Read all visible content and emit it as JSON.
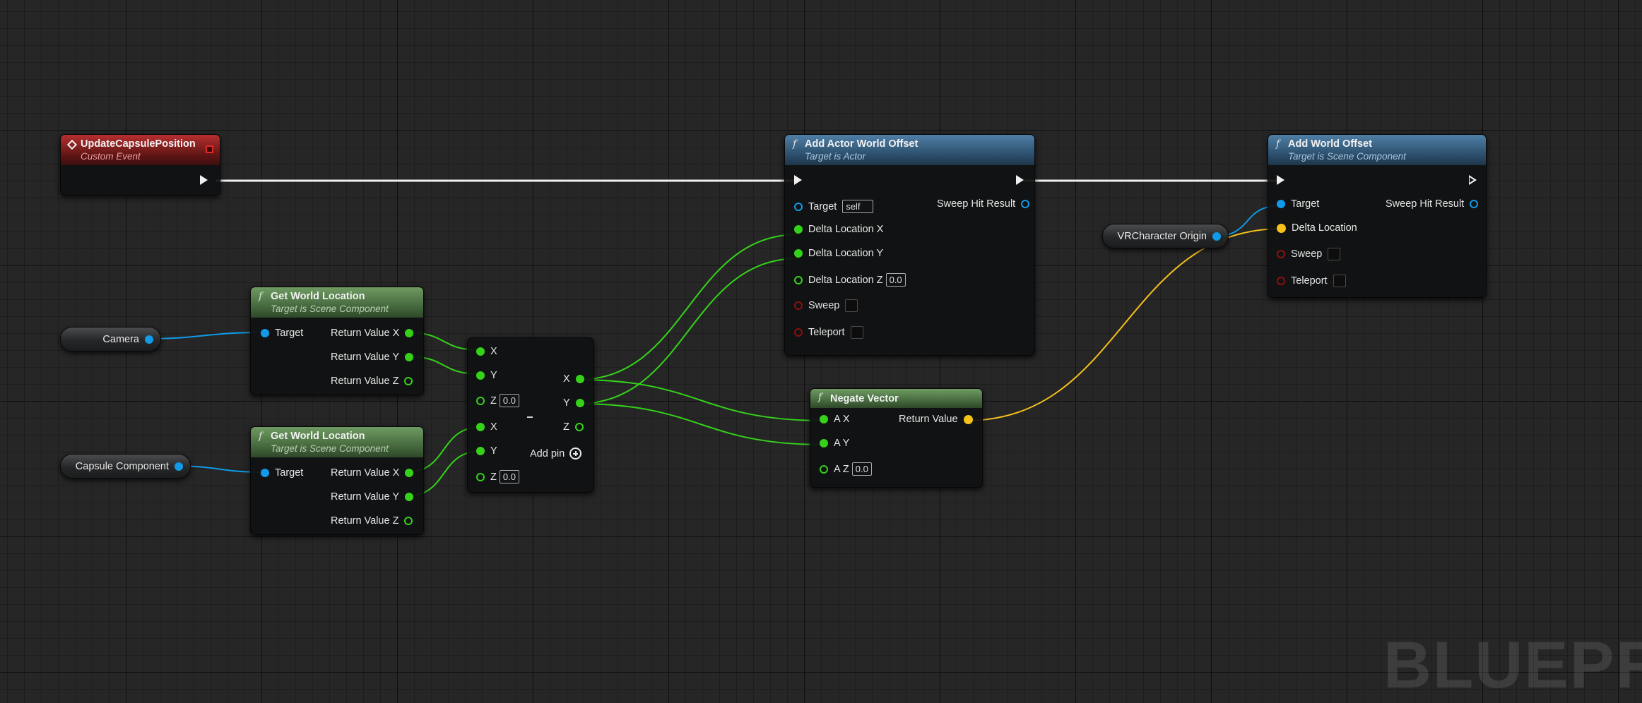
{
  "colors": {
    "background": "#262626",
    "exec_wire": "#f0f0f0",
    "float_pin": "#35d21a",
    "object_pin": "#109ae8",
    "vector_pin": "#f6c21a",
    "bool_pin": "#8c1010"
  },
  "event": {
    "title": "UpdateCapsulePosition",
    "subtitle": "Custom Event"
  },
  "add_actor_offset": {
    "title": "Add Actor World Offset",
    "subtitle": "Target is Actor",
    "target": "Target",
    "target_default": "self",
    "sweep_hit": "Sweep Hit Result",
    "dlx": "Delta Location X",
    "dly": "Delta Location Y",
    "dlz": "Delta Location Z",
    "dlz_default": "0.0",
    "sweep": "Sweep",
    "teleport": "Teleport"
  },
  "add_world_offset": {
    "title": "Add World Offset",
    "subtitle": "Target is Scene Component",
    "target": "Target",
    "sweep_hit": "Sweep Hit Result",
    "delta": "Delta Location",
    "sweep": "Sweep",
    "teleport": "Teleport"
  },
  "var_vr_origin": "VRCharacter Origin",
  "var_camera": "Camera",
  "var_capsule": "Capsule Component",
  "gwl_camera": {
    "title": "Get World Location",
    "subtitle": "Target is Scene Component",
    "target": "Target",
    "rx": "Return Value X",
    "ry": "Return Value Y",
    "rz": "Return Value Z"
  },
  "gwl_capsule": {
    "title": "Get World Location",
    "subtitle": "Target is Scene Component",
    "target": "Target",
    "rx": "Return Value X",
    "ry": "Return Value Y",
    "rz": "Return Value Z"
  },
  "subtract": {
    "x": "X",
    "y": "Y",
    "z": "Z",
    "z_default": "0.0",
    "x2": "X",
    "y2": "Y",
    "z2": "Z",
    "z2_default": "0.0",
    "out_x": "X",
    "out_y": "Y",
    "out_z": "Z",
    "add_pin": "Add pin"
  },
  "negate": {
    "title": "Negate Vector",
    "ax": "A X",
    "ay": "A Y",
    "az": "A Z",
    "az_default": "0.0",
    "ret": "Return Value"
  },
  "watermark": "BLUEPRINT"
}
